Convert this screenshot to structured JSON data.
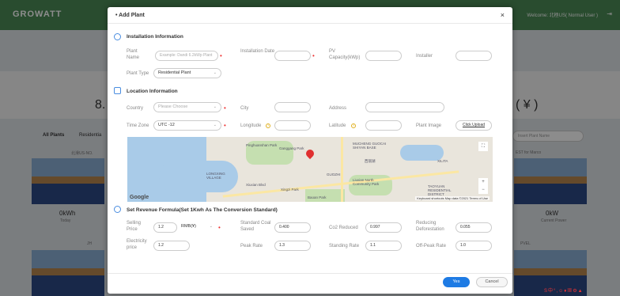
{
  "app": {
    "logo": "GROWATT",
    "welcome": "Welcome: 北極US( Normal User )"
  },
  "background": {
    "big_left": "8.",
    "big_right": "( ¥ )",
    "tab_all": "All Plants",
    "tab_res": "Residentia",
    "search_placeholder": "Insert Plant Name",
    "plant1_name": "北滑US-NO.",
    "plant2_name": "EST for Marco",
    "plant3_name": "JH",
    "plant4_name": "PVEL",
    "kwh_left": "0kWh",
    "kwh_left_sub": "Today",
    "kw_right": "0kW",
    "kw_right_sub": "Current Power"
  },
  "modal": {
    "title": "Add Plant",
    "close": "×",
    "installation": {
      "title": "Installation Information",
      "plant_name_label": "Plant Name",
      "plant_name_placeholder": "Example: Dandi 6.2kWp Plant",
      "installation_date_label": "Installation Date",
      "pv_capacity_label": "PV Capacity(kWp)",
      "installer_label": "Installer",
      "plant_type_label": "Plant Type",
      "plant_type_value": "Residential Plant"
    },
    "location": {
      "title": "Location Information",
      "country_label": "Country",
      "country_placeholder": "Please Choose",
      "city_label": "City",
      "address_label": "Address",
      "timezone_label": "Time Zone",
      "timezone_value": "UTC -12",
      "longitude_label": "Longitude",
      "latitude_label": "Latitude",
      "plant_image_label": "Plant Image",
      "upload_button": "Click Upload"
    },
    "map": {
      "google": "Google",
      "attribution": "Keyboard shortcuts   Map data ©2021   Terms of Use",
      "labels": [
        "Pinghuanshan Park",
        "Ganggang Park",
        "MUCHENG GUOCAI SHIYAN BASE",
        "西丽湖",
        "LONGXING VILLAGE",
        "GUOZHI",
        "Liuxian North Community Park",
        "TAOYUAN RESIDENTIAL DISTRICT",
        "Xingzi Park",
        "Baoan Park",
        "XILITA",
        "Xiuxian Blvd"
      ]
    },
    "revenue": {
      "title": "Set Revenue Formula(Set 1Kwh As The Conversion Standard)",
      "selling_price_label": "Selling Price",
      "selling_price_value": "1.2",
      "currency_value": "RMB(¥)",
      "standard_coal_label": "Standard Coal Saved",
      "standard_coal_value": "0.400",
      "co2_label": "Co2 Reduced",
      "co2_value": "0.997",
      "reducing_label": "Reducing Deforestation",
      "reducing_value": "0.055",
      "electricity_label": "Electricity price",
      "electricity_value": "1.2",
      "peak_label": "Peak Rate",
      "peak_value": "1.3",
      "standing_label": "Standing Rate",
      "standing_value": "1.1",
      "offpeak_label": "Off-Peak Rate",
      "offpeak_value": "1.0"
    },
    "footer": {
      "yes": "Yes",
      "cancel": "Cancel"
    }
  },
  "tray": "S中°,☺♦▦⚙▲"
}
